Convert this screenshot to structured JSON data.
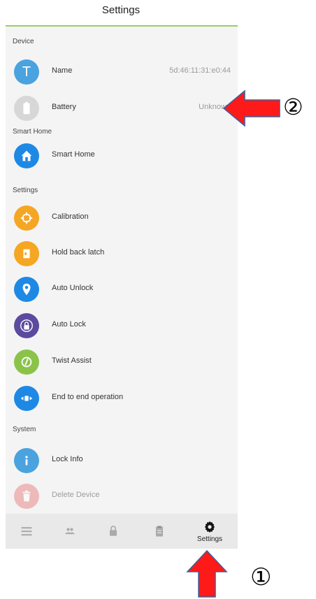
{
  "header": {
    "title": "Settings"
  },
  "sections": {
    "device": "Device",
    "smart_home": "Smart Home",
    "settings": "Settings",
    "system": "System"
  },
  "rows": {
    "name": {
      "label": "Name",
      "value": "5d:46:11:31:e0:44",
      "icon_letter": "T"
    },
    "battery": {
      "label": "Battery",
      "value": "Unknown"
    },
    "smart_home": {
      "label": "Smart Home"
    },
    "calibration": {
      "label": "Calibration"
    },
    "hold_back_latch": {
      "label": "Hold back latch"
    },
    "auto_unlock": {
      "label": "Auto Unlock"
    },
    "auto_lock": {
      "label": "Auto Lock"
    },
    "twist_assist": {
      "label": "Twist Assist"
    },
    "end_to_end": {
      "label": "End to end operation"
    },
    "lock_info": {
      "label": "Lock Info"
    },
    "delete_device": {
      "label": "Delete Device"
    }
  },
  "bottom_nav": {
    "settings_label": "Settings"
  },
  "annotations": {
    "marker_1": "①",
    "marker_2": "②"
  },
  "colors": {
    "accent_green": "#9ccc65",
    "blue": "#1e88e5",
    "light_blue": "#4aa3df",
    "orange": "#f5a623",
    "purple": "#5b4b9e",
    "olive": "#8bc34a",
    "red": "#e53935",
    "pink": "#e57373",
    "gray": "#cfcfcf"
  },
  "icons": [
    "text-avatar-icon",
    "battery-icon",
    "home-icon",
    "crosshair-icon",
    "latch-icon",
    "location-pin-icon",
    "padlock-icon",
    "twist-icon",
    "end-to-end-icon",
    "info-icon",
    "trash-icon",
    "menu-icon",
    "users-icon",
    "lock-icon",
    "clipboard-icon",
    "gear-icon"
  ]
}
